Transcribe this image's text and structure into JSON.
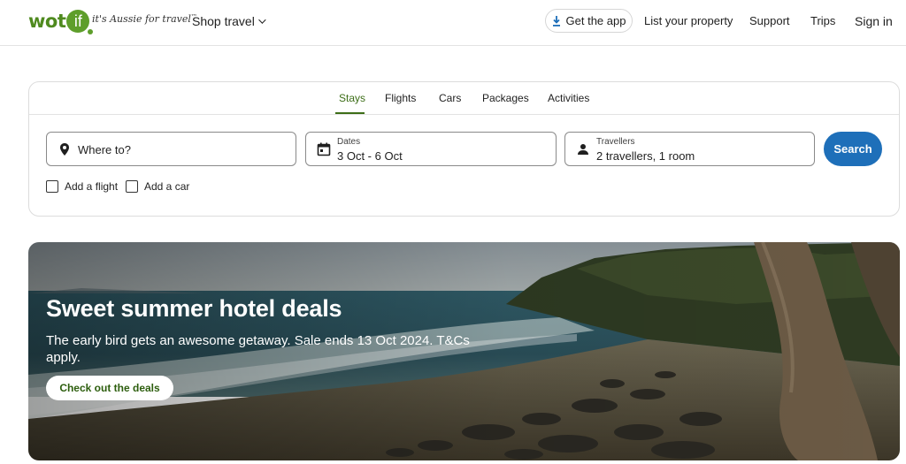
{
  "header": {
    "logo_text": "wot",
    "logo_if": "if",
    "tagline": "it's Aussie for travel",
    "tagline_mark": "™",
    "shop_travel": "Shop travel",
    "get_app": "Get the app",
    "list_property": "List your property",
    "support": "Support",
    "trips": "Trips",
    "sign_in": "Sign in"
  },
  "tabs": [
    "Stays",
    "Flights",
    "Cars",
    "Packages",
    "Activities"
  ],
  "active_tab": "Stays",
  "search": {
    "destination_placeholder": "Where to?",
    "dates_label": "Dates",
    "dates_value": "3 Oct - 6 Oct",
    "travellers_label": "Travellers",
    "travellers_value": "2 travellers, 1 room",
    "search_button": "Search",
    "add_flight": "Add a flight",
    "add_car": "Add a car"
  },
  "hero": {
    "title": "Sweet summer hotel deals",
    "subtitle": "The early bird gets an awesome getaway. Sale ends 13 Oct 2024. T&Cs apply.",
    "cta": "Check out the deals"
  },
  "colors": {
    "brand_green": "#5e9e2b",
    "active_tab": "#3d6e18",
    "search_button": "#1e6fb9"
  },
  "icons": {
    "download": "download-icon",
    "location": "map-pin-icon",
    "calendar": "calendar-icon",
    "person": "person-icon",
    "chevron": "chevron-down-icon"
  }
}
